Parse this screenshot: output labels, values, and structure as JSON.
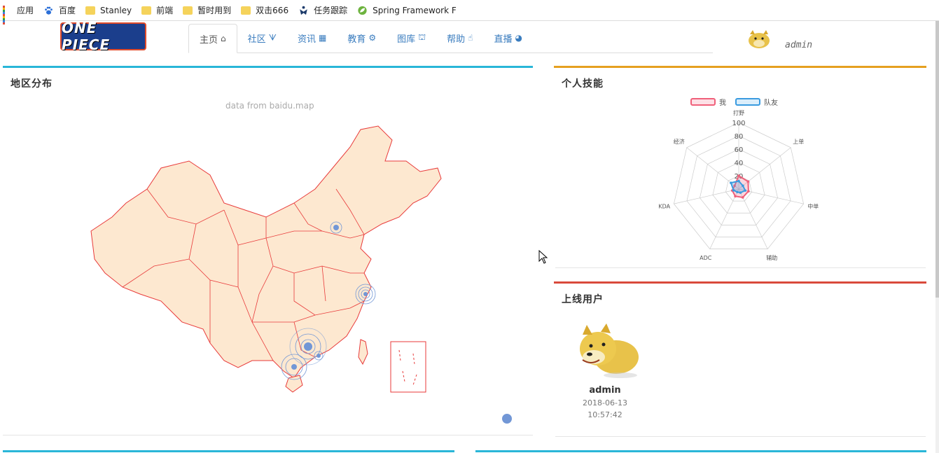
{
  "bookmarks": [
    {
      "label": "应用",
      "icon": "apps-icon"
    },
    {
      "label": "百度",
      "icon": "baidu-paw-icon"
    },
    {
      "label": "Stanley",
      "icon": "folder-icon"
    },
    {
      "label": "前端",
      "icon": "folder-icon"
    },
    {
      "label": "暂时用到",
      "icon": "folder-icon"
    },
    {
      "label": "双击666",
      "icon": "folder-icon"
    },
    {
      "label": "任务跟踪",
      "icon": "jira-icon"
    },
    {
      "label": "Spring Framework F",
      "icon": "spring-leaf-icon"
    }
  ],
  "header": {
    "logo_text": "ONE PIECE",
    "user_name": "admin",
    "nav": [
      {
        "label": "主页",
        "icon": "home-icon",
        "glyph": "⌂",
        "active": true
      },
      {
        "label": "社区",
        "icon": "vine-icon",
        "glyph": "ᗐ",
        "active": false
      },
      {
        "label": "资讯",
        "icon": "map-icon",
        "glyph": "▦",
        "active": false
      },
      {
        "label": "教育",
        "icon": "steam-icon",
        "glyph": "⚙",
        "active": false
      },
      {
        "label": "图库",
        "icon": "bank-icon",
        "glyph": "⛫",
        "active": false
      },
      {
        "label": "帮助",
        "icon": "hand-pointer-icon",
        "glyph": "☝",
        "active": false
      },
      {
        "label": "直播",
        "icon": "dribbble-icon",
        "glyph": "◕",
        "active": false
      }
    ]
  },
  "region_panel": {
    "title": "地区分布",
    "map_subtitle": "data from baidu.map",
    "accent": "#29b6d8"
  },
  "skills_panel": {
    "title": "个人技能",
    "accent": "#e5a020",
    "legend": [
      {
        "name": "我",
        "color": "#f0607a"
      },
      {
        "name": "队友",
        "color": "#3a9be0"
      }
    ],
    "chart_data": {
      "type": "radar",
      "indicators": [
        "打野",
        "上单",
        "中单",
        "辅助",
        "ADC",
        "KDA",
        "经济"
      ],
      "max": 100,
      "ticks": [
        "20",
        "40",
        "60",
        "80",
        "100"
      ],
      "series": [
        {
          "name": "我",
          "values": [
            20,
            18,
            15,
            14,
            12,
            10,
            8
          ]
        },
        {
          "name": "队友",
          "values": [
            12,
            8,
            10,
            6,
            5,
            8,
            15
          ]
        }
      ]
    }
  },
  "online_panel": {
    "title": "上线用户",
    "accent": "#d94a3c",
    "user": {
      "name": "admin",
      "date": "2018-06-13",
      "time": "10:57:42"
    }
  },
  "bottom_panels": [
    {
      "accent": "#29b6d8"
    },
    {
      "accent": "#29b6d8"
    }
  ]
}
